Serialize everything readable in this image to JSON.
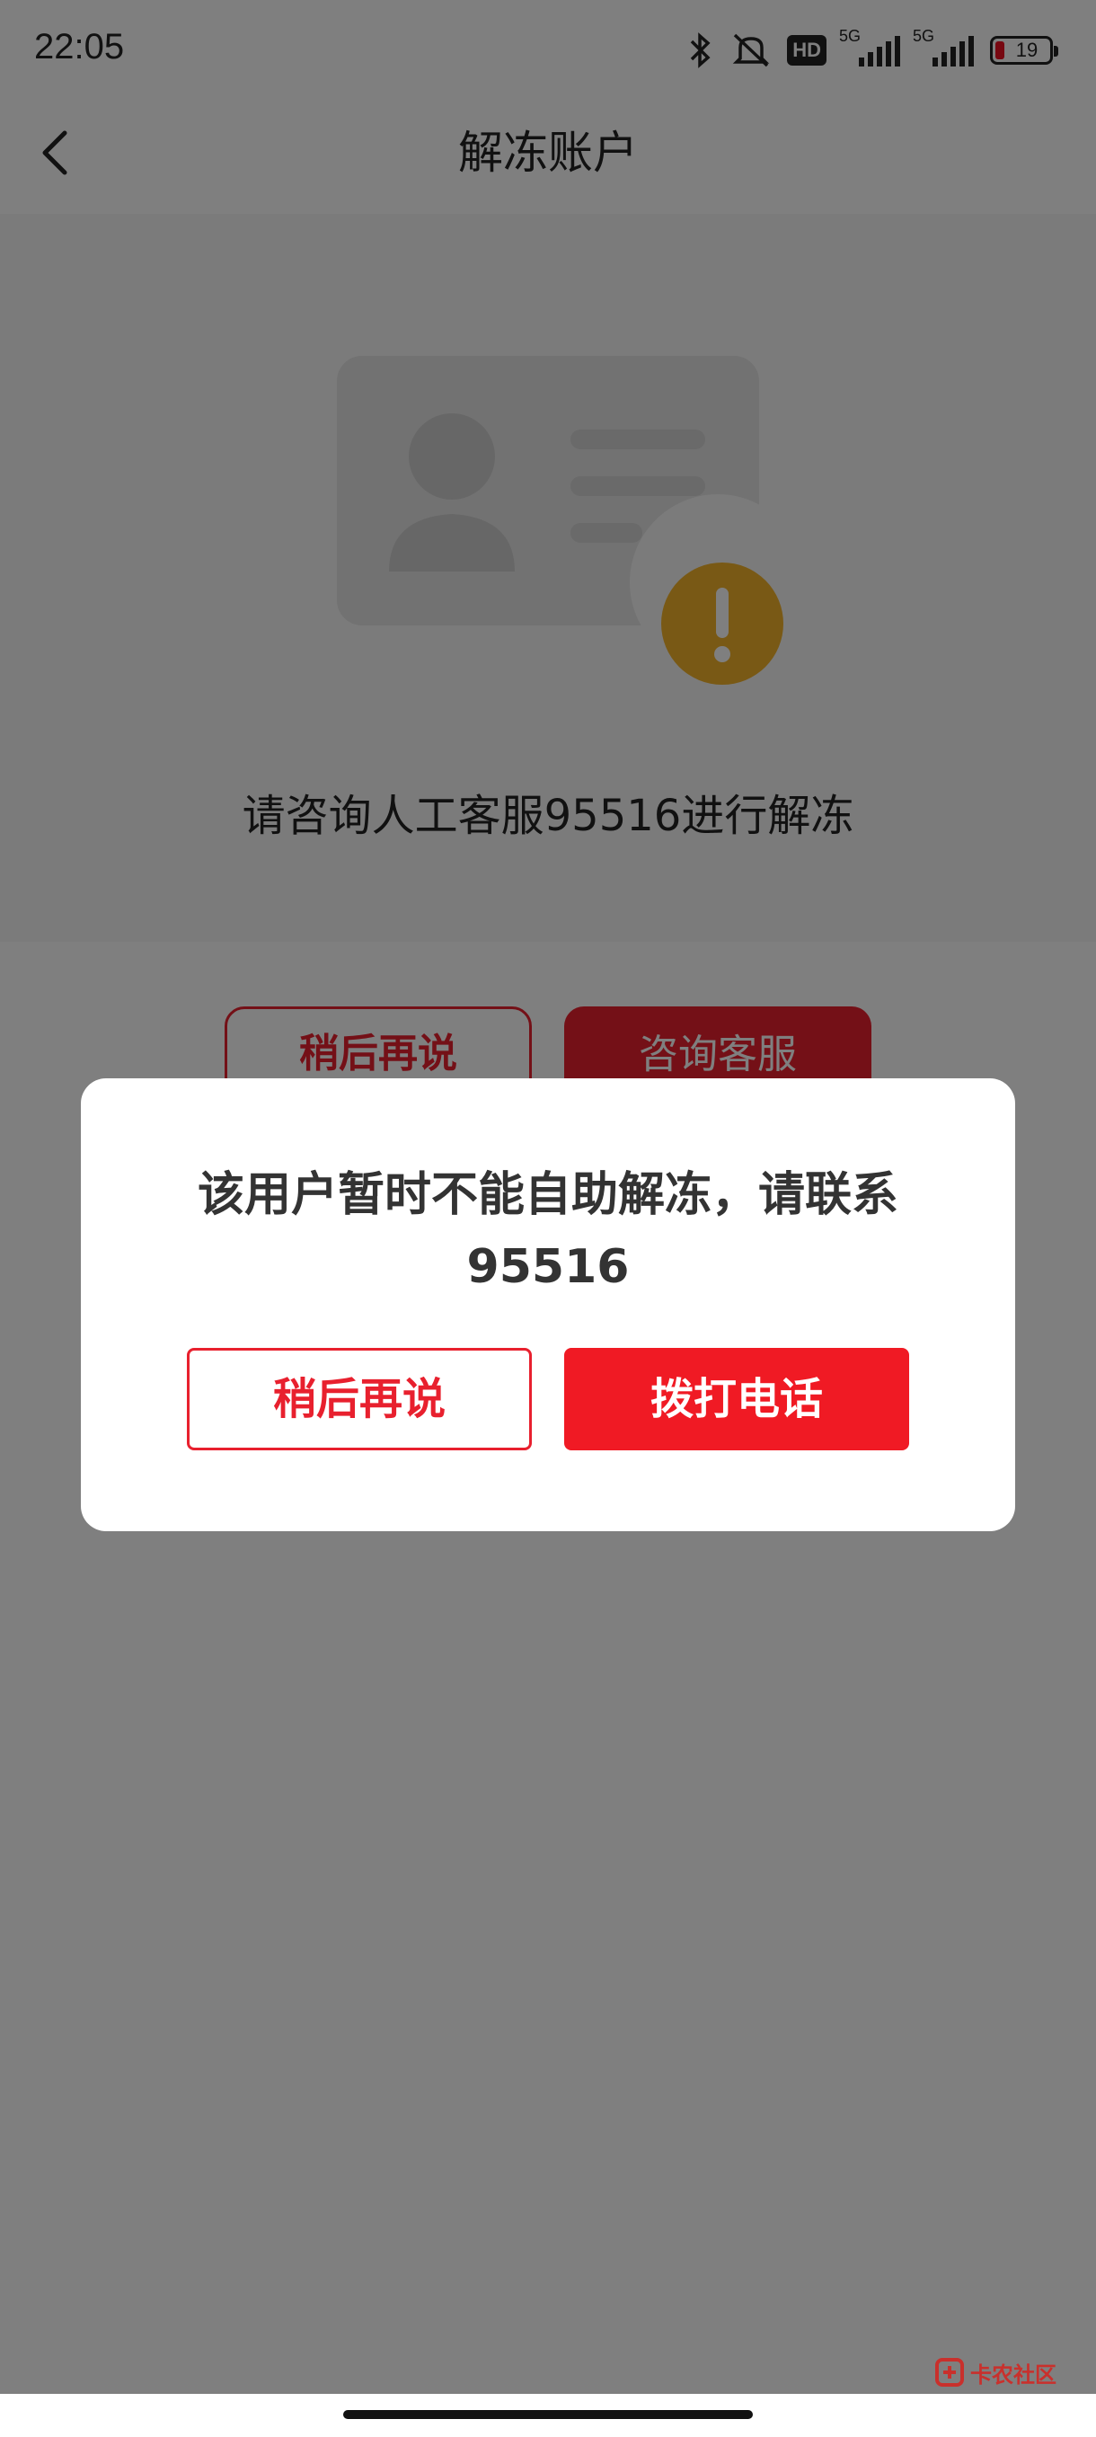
{
  "status_bar": {
    "time": "22:05",
    "hd_label": "HD",
    "network_label_1": "5G",
    "network_label_2": "5G",
    "battery_level": "19",
    "icons": [
      "bluetooth-icon",
      "mute-icon",
      "hd-icon",
      "signal-icon",
      "signal-icon",
      "battery-icon"
    ],
    "battery_color": "#e12020"
  },
  "nav": {
    "title": "解冻账户",
    "back_icon": "chevron-left-icon"
  },
  "page": {
    "hint": "请咨询人工客服95516进行解冻",
    "later_label": "稍后再说",
    "consult_label": "咨询客服",
    "illustration": "id-card-warning-icon",
    "accent_color": "#e8202e",
    "warning_color": "#f2b22a"
  },
  "dialog": {
    "message": "该用户暂时不能自助解冻，请联系95516",
    "later_label": "稍后再说",
    "call_label": "拨打电话",
    "call_color": "#f01a24"
  },
  "watermark": {
    "text": "卡农社区"
  }
}
